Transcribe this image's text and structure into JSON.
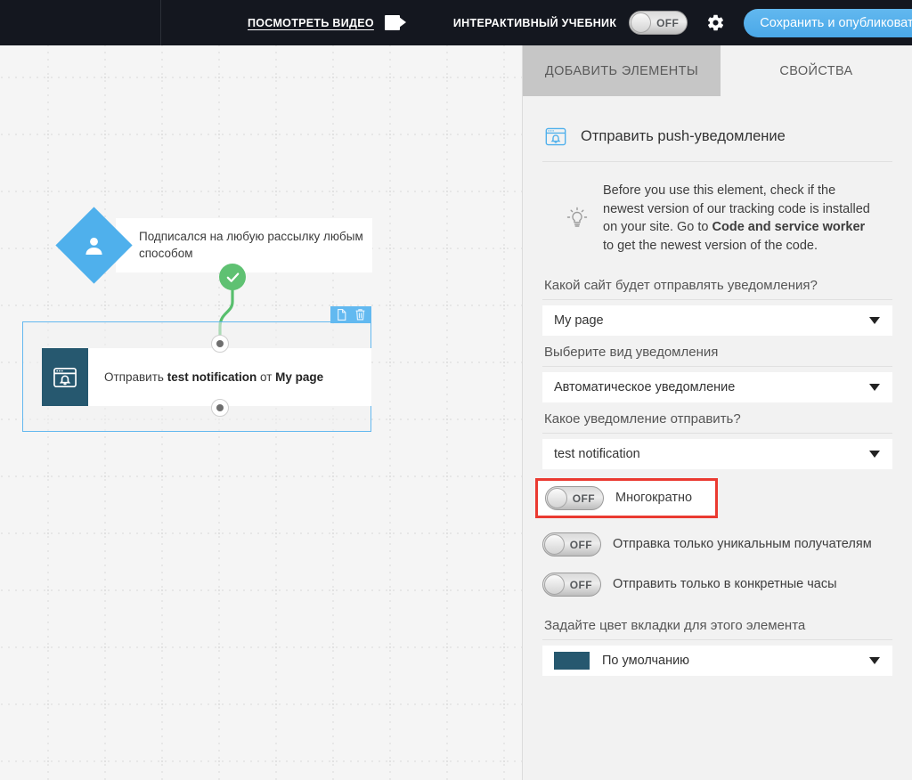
{
  "topbar": {
    "video_link": "ПОСМОТРЕТЬ ВИДЕО",
    "video_icon": "video-camera-icon",
    "tutorial_label": "ИНТЕРАКТИВНЫЙ УЧЕБНИК",
    "tutorial_toggle_state": "OFF",
    "gear_icon": "gear-icon",
    "publish_button": "Сохранить и опубликовать",
    "publish_caret_icon": "chevron-down-icon",
    "background_color": "#14171f",
    "publish_color": "#4aa8e8"
  },
  "canvas": {
    "trigger_node": {
      "icon": "person-icon",
      "label": "Подписался на любую рассылку любым способом",
      "diamond_color": "#4fb0ec"
    },
    "connector": {
      "status_icon": "check-circle-icon",
      "color": "#5fc172"
    },
    "action_node": {
      "icon": "push-notification-icon",
      "icon_box_color": "#26586f",
      "text_prefix": "Отправить",
      "text_bold_1": "test notification",
      "text_middle": "от",
      "text_bold_2": "My page",
      "selected": "true",
      "selection_color": "#63b8ef",
      "toolbar": {
        "copy_icon": "duplicate-icon",
        "delete_icon": "trash-icon"
      },
      "port_top": "connector-port-in",
      "port_bottom": "connector-port-out"
    }
  },
  "panel": {
    "tabs": [
      {
        "label": "ДОБАВИТЬ ЭЛЕМЕНТЫ",
        "active": true
      },
      {
        "label": "СВОЙСТВА",
        "active": false
      }
    ],
    "header": {
      "icon": "push-notification-icon",
      "title": "Отправить push-уведомление"
    },
    "hint": {
      "icon": "lightbulb-icon",
      "text_part1": "Before you use this element, check if the newest version of our tracking code is installed on your site. Go to ",
      "bold1": "Code and service worker",
      "text_part2": " to get the newest version of the code."
    },
    "fields": [
      {
        "label": "Какой сайт будет отправлять уведомления?",
        "value": "My page",
        "type": "select"
      },
      {
        "label": "Выберите вид уведомления",
        "value": "Автоматическое уведомление",
        "type": "select"
      },
      {
        "label": "Какое уведомление отправить?",
        "value": "test notification",
        "type": "select"
      }
    ],
    "switches": [
      {
        "state": "OFF",
        "label": "Многократно",
        "highlighted": true,
        "highlight_color": "#ea3a31"
      },
      {
        "state": "OFF",
        "label": "Отправка только уникальным получателям",
        "highlighted": false
      },
      {
        "state": "OFF",
        "label": "Отправить только в конкретные часы",
        "highlighted": false
      }
    ],
    "color_field": {
      "label": "Задайте цвет вкладки для этого элемента",
      "value": "По умолчанию",
      "swatch_color": "#26586f"
    }
  }
}
